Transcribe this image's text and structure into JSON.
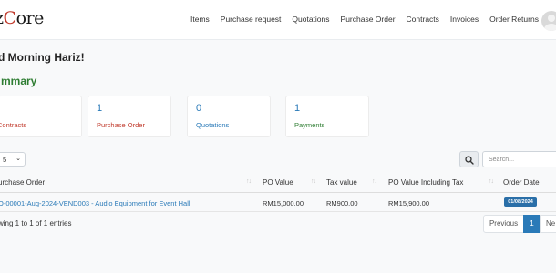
{
  "brand": {
    "name_main": "z",
    "name_accent": "C",
    "name_rest": "ore"
  },
  "nav": {
    "items": [
      "Items",
      "Purchase request",
      "Quotations",
      "Purchase Order",
      "Contracts",
      "Invoices",
      "Order Returns"
    ]
  },
  "greeting": "d Morning Hariz!",
  "summary": {
    "heading": "mmary",
    "cards": [
      {
        "value": "",
        "label": "Contracts"
      },
      {
        "value": "1",
        "label": "Purchase Order"
      },
      {
        "value": "0",
        "label": "Quotations"
      },
      {
        "value": "1",
        "label": "Payments"
      }
    ]
  },
  "table_controls": {
    "length_value": "5",
    "search_placeholder": "Search..."
  },
  "table": {
    "headers": [
      "urchase Order",
      "PO Value",
      "Tax value",
      "PO Value Including Tax",
      "Order Date"
    ],
    "rows": [
      {
        "purchase_order": "O-00001-Aug-2024-VEND003 - Audio Equipment for Event Hall",
        "po_value": "RM15,000.00",
        "tax_value": "RM900.00",
        "po_value_incl_tax": "RM15,900.00",
        "order_date": "01/08/2024"
      }
    ]
  },
  "info": "wing 1 to 1 of 1 entries",
  "pagination": {
    "previous": "Previous",
    "current": "1",
    "next": "Ne"
  },
  "colors": {
    "link": "#2a7ab8",
    "summary_green": "#2e7d32",
    "contracts_red": "#c0392b",
    "badge": "#2a6fa8"
  },
  "icons": {
    "search": "search-icon",
    "avatar": "user-avatar-icon",
    "sort": "sort-icon"
  }
}
